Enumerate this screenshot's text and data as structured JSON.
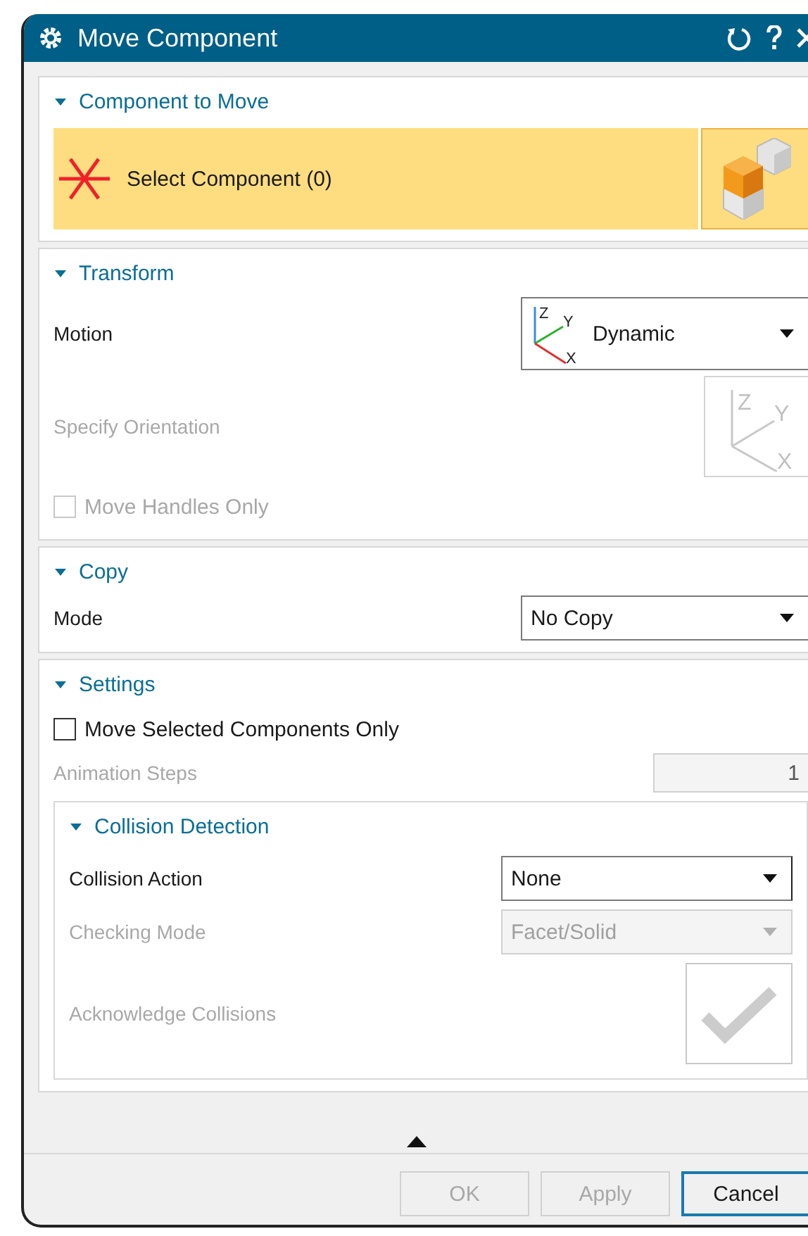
{
  "window": {
    "title": "Move Component"
  },
  "sections": [
    {
      "title": "Component to Move",
      "expanded": true,
      "rows": [
        {
          "kind": "selection",
          "label": "Select Component (0)"
        }
      ]
    },
    {
      "title": "Transform",
      "expanded": true,
      "rows": [
        {
          "kind": "triad-dropdown",
          "label": "Motion",
          "value": "Dynamic",
          "axis_labels": [
            "Z",
            "Y",
            "X"
          ],
          "disabled": false
        },
        {
          "kind": "orientation",
          "label": "Specify Orientation",
          "axis_labels": [
            "Z",
            "Y",
            "X"
          ],
          "disabled": true
        },
        {
          "kind": "checkbox",
          "label": "Move Handles Only",
          "checked": false,
          "disabled": true
        }
      ]
    },
    {
      "title": "Copy",
      "expanded": true,
      "rows": [
        {
          "kind": "dropdown",
          "label": "Mode",
          "value": "No Copy",
          "disabled": false
        }
      ]
    },
    {
      "title": "Settings",
      "expanded": true,
      "rows": [
        {
          "kind": "checkbox",
          "label": "Move Selected Components Only",
          "checked": false,
          "disabled": false
        },
        {
          "kind": "number",
          "label": "Animation Steps",
          "value": "1",
          "disabled": true
        },
        {
          "kind": "group",
          "title": "Collision Detection",
          "expanded": true,
          "rows": [
            {
              "kind": "dropdown",
              "label": "Collision Action",
              "value": "None",
              "disabled": false
            },
            {
              "kind": "dropdown",
              "label": "Checking Mode",
              "value": "Facet/Solid",
              "disabled": true
            },
            {
              "kind": "toggle",
              "label": "Acknowledge Collisions",
              "disabled": true
            }
          ]
        }
      ]
    }
  ],
  "footer": {
    "collapsed": false,
    "buttons": [
      {
        "label": "OK",
        "disabled": true,
        "default": false
      },
      {
        "label": "Apply",
        "disabled": true,
        "default": false
      },
      {
        "label": "Cancel",
        "disabled": false,
        "default": true
      }
    ]
  }
}
